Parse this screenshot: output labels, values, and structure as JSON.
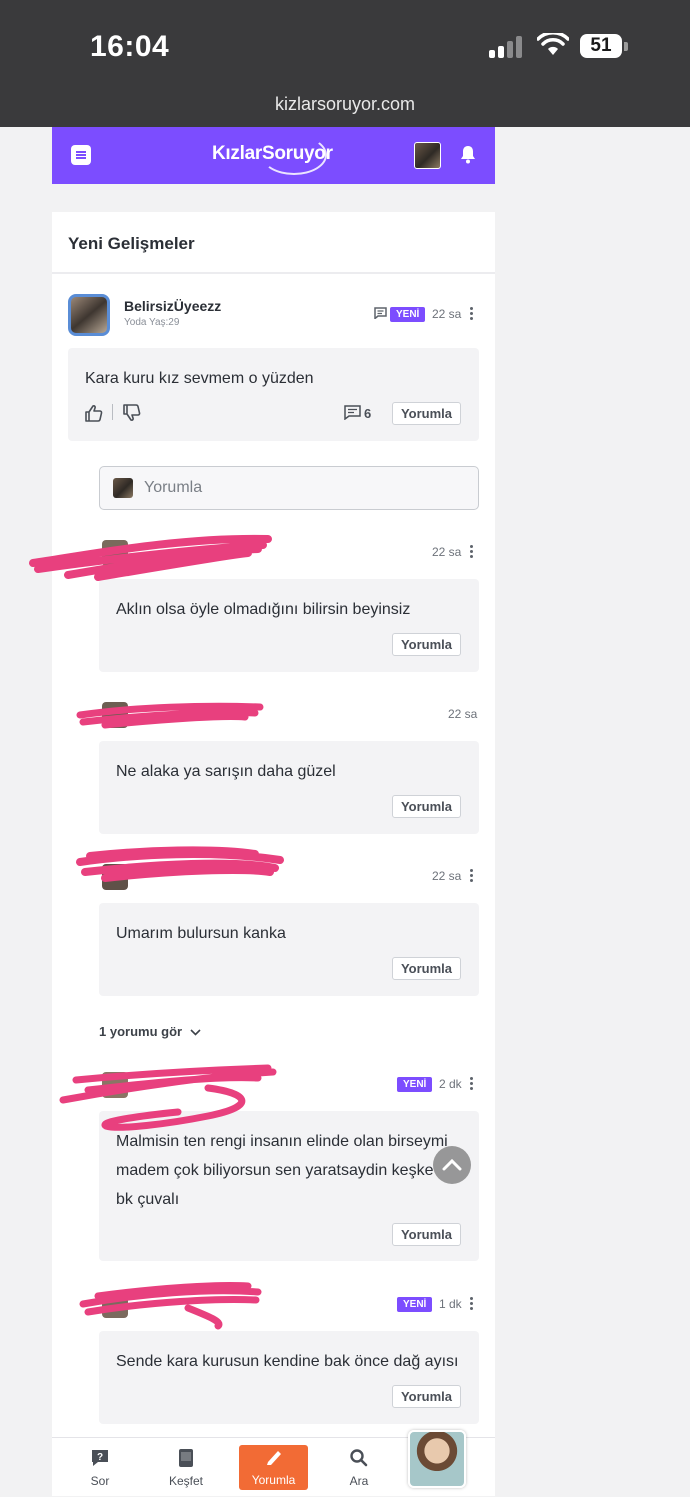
{
  "status_bar": {
    "time": "16:04",
    "battery": "51",
    "url": "kizlarsoruyor.com"
  },
  "topbar": {
    "logo": "KızlarSoruyor"
  },
  "panel": {
    "title": "Yeni Gelişmeler"
  },
  "post": {
    "author": "BelirsizÜyeezz",
    "author_sub": "Yoda Yaş:29",
    "badge": "YENİ",
    "time": "22 sa",
    "text": "Kara kuru kız sevmem o yüzden",
    "comment_count": "6",
    "reply_label": "Yorumla"
  },
  "comment_input": {
    "placeholder": "Yorumla"
  },
  "comments": [
    {
      "time": "22 sa",
      "text": "Aklın olsa öyle olmadığını bilirsin beyinsiz",
      "reply_label": "Yorumla"
    },
    {
      "time": "22 sa",
      "text": "Ne alaka ya sarışın daha güzel",
      "reply_label": "Yorumla"
    },
    {
      "time": "22 sa",
      "text": "Umarım bulursun kanka",
      "reply_label": "Yorumla"
    },
    {
      "badge": "YENİ",
      "time": "2 dk",
      "text_lines": [
        "Malmisin ten rengi insanın elinde olan birseymi",
        "madem çok biliyorsun sen yaratsaydin keşke",
        "bk çuvalı"
      ],
      "reply_label": "Yorumla"
    },
    {
      "badge": "YENİ",
      "time": "1 dk",
      "text": "Sende kara kurusun kendine bak önce dağ ayısı",
      "reply_label": "Yorumla"
    }
  ],
  "see_more": "1 yorumu gör",
  "bottom_nav": [
    {
      "label": "Sor",
      "icon": "question-icon"
    },
    {
      "label": "Keşfet",
      "icon": "discover-icon"
    },
    {
      "label": "Yorumla",
      "icon": "pencil-icon"
    },
    {
      "label": "Ara",
      "icon": "search-icon"
    }
  ],
  "colors": {
    "brand": "#7c4dff",
    "accent": "#f26b35",
    "redaction": "#e8407e"
  }
}
